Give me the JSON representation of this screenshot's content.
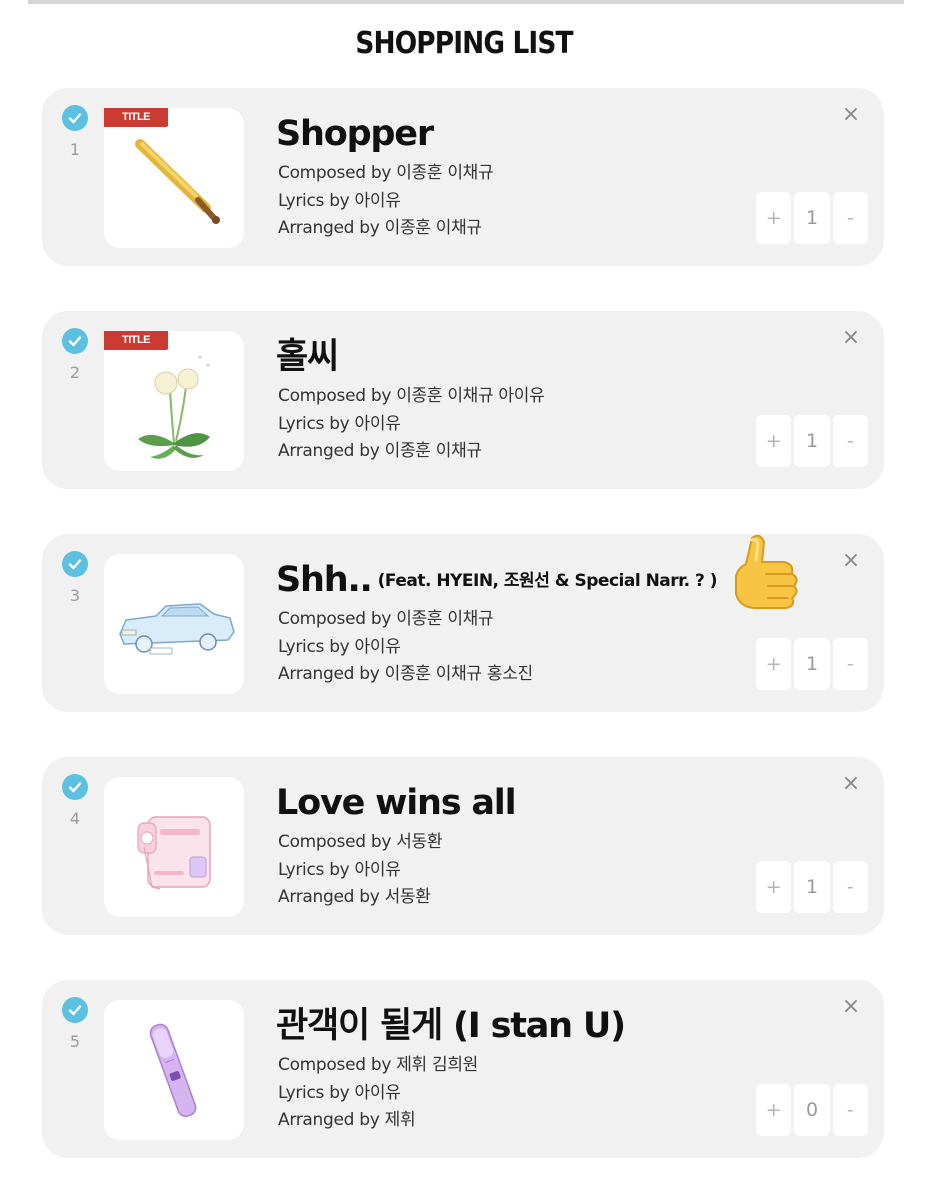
{
  "header": {
    "title": "SHOPPING LIST"
  },
  "items": [
    {
      "number": "1",
      "badge": "TITLE",
      "title": "Shopper",
      "feat": "",
      "composed": "Composed by 이종훈 이채규",
      "lyrics": "Lyrics by 아이유",
      "arranged": "Arranged by 이종훈 이채규",
      "plus": "+",
      "qty": "1",
      "minus": "-",
      "close": "×",
      "image": "baseball-bat"
    },
    {
      "number": "2",
      "badge": "TITLE",
      "title": "홀씨",
      "feat": "",
      "composed": "Composed by 이종훈 이채규 아이유",
      "lyrics": "Lyrics by 아이유",
      "arranged": "Arranged by 이종훈 이채규",
      "plus": "+",
      "qty": "1",
      "minus": "-",
      "close": "×",
      "image": "dandelion"
    },
    {
      "number": "3",
      "badge": "",
      "title": "Shh..",
      "feat": "(Feat. HYEIN, 조원선 & Special Narr. ? )",
      "composed": "Composed by 이종훈 이채규",
      "lyrics": "Lyrics by 아이유",
      "arranged": "Arranged by 이종훈 이채규 홍소진",
      "plus": "+",
      "qty": "1",
      "minus": "-",
      "close": "×",
      "image": "car"
    },
    {
      "number": "4",
      "badge": "",
      "title": "Love wins all",
      "feat": "",
      "composed": "Composed by 서동환",
      "lyrics": "Lyrics by 아이유",
      "arranged": "Arranged by 서동환",
      "plus": "+",
      "qty": "1",
      "minus": "-",
      "close": "×",
      "image": "camcorder"
    },
    {
      "number": "5",
      "badge": "",
      "title": "관객이 될게 (I stan U)",
      "feat": "",
      "composed": "Composed by 제휘 김희원",
      "lyrics": "Lyrics by 아이유",
      "arranged": "Arranged by 제휘",
      "plus": "+",
      "qty": "0",
      "minus": "-",
      "close": "×",
      "image": "lightstick"
    }
  ],
  "overlay": {
    "emoji": "thumbs-up-icon"
  },
  "colors": {
    "check": "#5cc0e0",
    "badge": "#cc3b32",
    "card": "#f1f1f1"
  }
}
